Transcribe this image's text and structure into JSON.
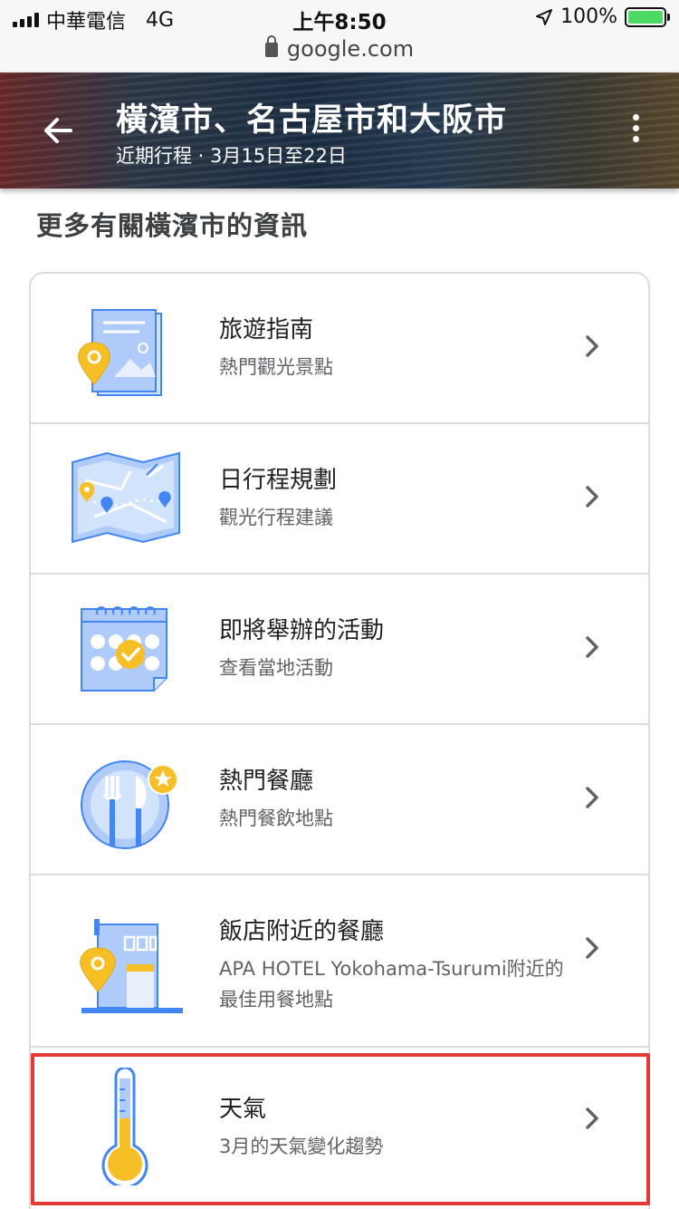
{
  "status_bar": {
    "carrier": "中華電信",
    "network": "4G",
    "time": "上午8:50",
    "battery": "100%"
  },
  "browser": {
    "url": "google.com"
  },
  "header": {
    "title": "橫濱市、名古屋市和大阪市",
    "subtitle": "近期行程 · 3月15日至22日"
  },
  "section": {
    "title": "更多有關橫濱市的資訊"
  },
  "items": [
    {
      "title": "旅遊指南",
      "subtitle": "熱門觀光景點",
      "icon": "travel-guide-icon"
    },
    {
      "title": "日行程規劃",
      "subtitle": "觀光行程建議",
      "icon": "day-plan-map-icon"
    },
    {
      "title": "即將舉辦的活動",
      "subtitle": "查看當地活動",
      "icon": "events-calendar-icon"
    },
    {
      "title": "熱門餐廳",
      "subtitle": "熱門餐飲地點",
      "icon": "restaurant-icon"
    },
    {
      "title": "飯店附近的餐廳",
      "subtitle": "APA HOTEL Yokohama-Tsurumi附近的最佳用餐地點",
      "icon": "hotel-restaurant-icon"
    },
    {
      "title": "天氣",
      "subtitle": "3月的天氣變化趨勢",
      "icon": "thermometer-icon"
    }
  ],
  "colors": {
    "accent_blue": "#4285f4",
    "light_blue": "#aecbfa",
    "yellow": "#f6bf26",
    "highlight_red": "#e53935"
  }
}
